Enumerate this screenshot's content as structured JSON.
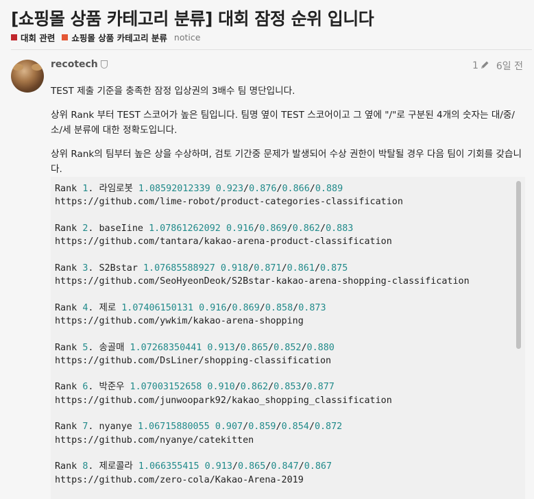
{
  "topic": {
    "title": "[쇼핑몰 상품 카테고리 분류] 대회 잠정 순위 입니다",
    "categories": [
      {
        "label": "대회 관련",
        "color": "#c0262c"
      },
      {
        "label": "쇼핑몰 상품 카테고리 분류",
        "color": "#e45735"
      }
    ],
    "tag": "notice"
  },
  "post": {
    "username": "recotech",
    "edit_count": "1",
    "age": "6일 전",
    "paragraphs": [
      "TEST 제출 기준을 충족한 잠정 입상권의 3배수 팀 명단입니다.",
      "상위 Rank 부터 TEST 스코어가 높은 팀입니다. 팀명 옆이 TEST 스코어이고 그 옆에 \"/\"로 구분된 4개의 숫자는 대/중/소/세 분류에 대한 정확도입니다.",
      "상위 Rank의 팀부터 높은 상을 수상하며, 검토 기간중 문제가 발생되어 수상 권한이 박탈될 경우 다음 팀이 기회를 갖습니다."
    ]
  },
  "rankings": [
    {
      "rank": "1",
      "team": "라임로봇",
      "score": "1.08592012339",
      "acc": [
        "0.923",
        "0.876",
        "0.866",
        "0.889"
      ],
      "url": "https://github.com/lime-robot/product-categories-classification"
    },
    {
      "rank": "2",
      "team": "baseIine",
      "score": "1.07861262092",
      "acc": [
        "0.916",
        "0.869",
        "0.862",
        "0.883"
      ],
      "url": "https://github.com/tantara/kakao-arena-product-classification"
    },
    {
      "rank": "3",
      "team": "S2Bstar",
      "score": "1.07685588927",
      "acc": [
        "0.918",
        "0.871",
        "0.861",
        "0.875"
      ],
      "url": "https://github.com/SeoHyeonDeok/S2Bstar-kakao-arena-shopping-classification"
    },
    {
      "rank": "4",
      "team": "제로",
      "score": "1.07406150131",
      "acc": [
        "0.916",
        "0.869",
        "0.858",
        "0.873"
      ],
      "url": "https://github.com/ywkim/kakao-arena-shopping"
    },
    {
      "rank": "5",
      "team": "송골매",
      "score": "1.07268350441",
      "acc": [
        "0.913",
        "0.865",
        "0.852",
        "0.880"
      ],
      "url": "https://github.com/DsLiner/shopping-classification"
    },
    {
      "rank": "6",
      "team": "박준우",
      "score": "1.07003152658",
      "acc": [
        "0.910",
        "0.862",
        "0.853",
        "0.877"
      ],
      "url": "https://github.com/junwoopark92/kakao_shopping_classification"
    },
    {
      "rank": "7",
      "team": "nyanye",
      "score": "1.06715880055",
      "acc": [
        "0.907",
        "0.859",
        "0.854",
        "0.872"
      ],
      "url": "https://github.com/nyanye/catekitten"
    },
    {
      "rank": "8",
      "team": "제로콜라",
      "score": "1.066355415",
      "acc": [
        "0.913",
        "0.865",
        "0.847",
        "0.867"
      ],
      "url": "https://github.com/zero-cola/Kakao-Arena-2019"
    }
  ]
}
